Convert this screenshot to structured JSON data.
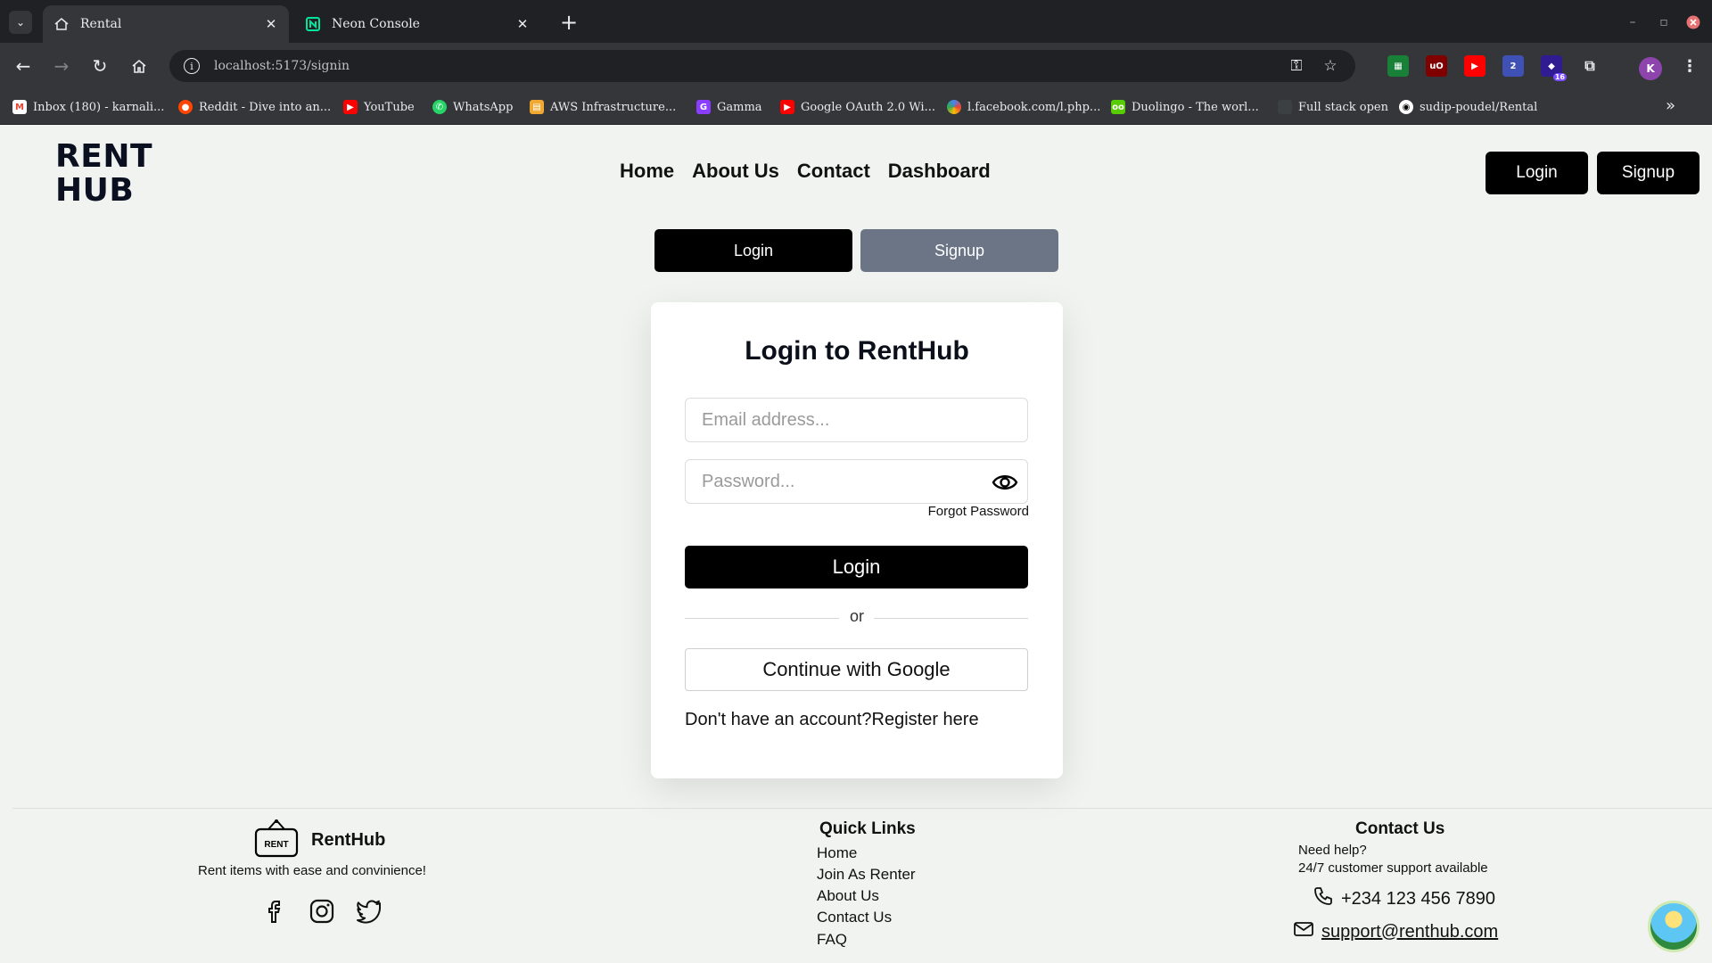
{
  "browser": {
    "tabs": [
      {
        "title": "Rental",
        "active": true
      },
      {
        "title": "Neon Console",
        "active": false
      }
    ],
    "url": "localhost:5173/signin",
    "extension_badges": {
      "notifications": "16"
    },
    "bookmarks": [
      {
        "label": "Inbox (180) - karnali...",
        "icon": "gmail-icon",
        "color": "#ea4335"
      },
      {
        "label": "Reddit - Dive into an...",
        "icon": "reddit-icon",
        "color": "#ff4500"
      },
      {
        "label": "YouTube",
        "icon": "youtube-icon",
        "color": "#ff0000"
      },
      {
        "label": "WhatsApp",
        "icon": "whatsapp-icon",
        "color": "#25d366"
      },
      {
        "label": "AWS Infrastructure...",
        "icon": "aws-icon",
        "color": "#f0a830"
      },
      {
        "label": "Gamma",
        "icon": "gamma-icon",
        "color": "#8b3dff"
      },
      {
        "label": "Google OAuth 2.0 Wi...",
        "icon": "youtube-icon",
        "color": "#ff0000"
      },
      {
        "label": "l.facebook.com/l.php...",
        "icon": "pinwheel-icon",
        "color": "#4285f4"
      },
      {
        "label": "Duolingo - The worl...",
        "icon": "duolingo-icon",
        "color": "#58cc02"
      },
      {
        "label": "Full stack open",
        "icon": "page-icon",
        "color": "#3c4043"
      },
      {
        "label": "sudip-poudel/Rental",
        "icon": "github-icon",
        "color": "#000000"
      }
    ]
  },
  "header": {
    "logo_line1": "RENT",
    "logo_line2": "HUB",
    "nav": [
      "Home",
      "About Us",
      "Contact",
      "Dashboard"
    ],
    "login_label": "Login",
    "signup_label": "Signup"
  },
  "switcher": {
    "login_label": "Login",
    "signup_label": "Signup"
  },
  "form": {
    "title": "Login to RentHub",
    "email_placeholder": "Email address...",
    "password_placeholder": "Password...",
    "forgot_label": "Forgot Password",
    "submit_label": "Login",
    "or_label": "or",
    "google_label": "Continue with Google",
    "register_prompt": "Don't have an account?",
    "register_link": "Register here"
  },
  "footer": {
    "brand_badge": "RENT",
    "brand_name": "RentHub",
    "tagline": "Rent items with ease and convinience!",
    "quick_links_heading": "Quick Links",
    "quick_links": [
      "Home",
      "Join As Renter",
      "About Us",
      "Contact Us",
      "FAQ"
    ],
    "contact_heading": "Contact Us",
    "contact_help": "Need help?",
    "contact_support": "24/7 customer support available",
    "phone": "+234 123 456 7890",
    "email": "support@renthub.com"
  },
  "colors": {
    "primary": "#000000",
    "inactive_tab": "#6b7586",
    "page_bg": "#f1f3f1"
  }
}
